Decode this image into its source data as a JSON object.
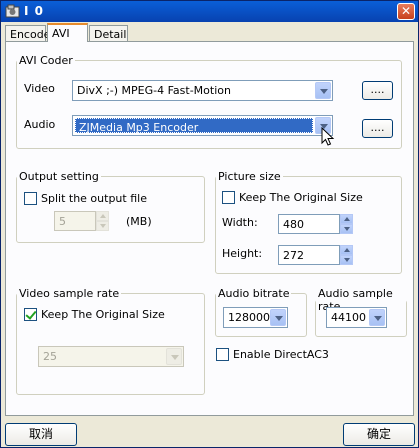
{
  "window": {
    "title": "I 0",
    "close_label": "✕"
  },
  "tabs": [
    {
      "label": "Encode",
      "active": false
    },
    {
      "label": "AVI",
      "active": true
    },
    {
      "label": "Detail",
      "active": false
    }
  ],
  "avi_coder": {
    "legend": "AVI Coder",
    "video_label": "Video",
    "video_value": "DivX ;-) MPEG-4 Fast-Motion",
    "audio_label": "Audio",
    "audio_value": "ZJMedia Mp3 Encoder",
    "config_button": "...."
  },
  "output_setting": {
    "legend": "Output setting",
    "split_label": "Split the output file",
    "split_checked": false,
    "split_value": "5",
    "unit": "(MB)"
  },
  "picture_size": {
    "legend": "Picture size",
    "keep_label": "Keep The Original Size",
    "keep_checked": false,
    "width_label": "Width:",
    "width_value": "480",
    "height_label": "Height:",
    "height_value": "272"
  },
  "video_sample_rate": {
    "legend": "Video sample rate",
    "keep_label": "Keep The Original Size",
    "keep_checked": true,
    "rate_value": "25"
  },
  "audio_bitrate": {
    "legend": "Audio bitrate",
    "value": "128000"
  },
  "audio_sample_rate": {
    "legend": "Audio sample rate",
    "value": "44100"
  },
  "direct_ac3": {
    "label": "Enable DirectAC3",
    "checked": false
  },
  "buttons": {
    "cancel": "取消",
    "ok": "确定"
  }
}
